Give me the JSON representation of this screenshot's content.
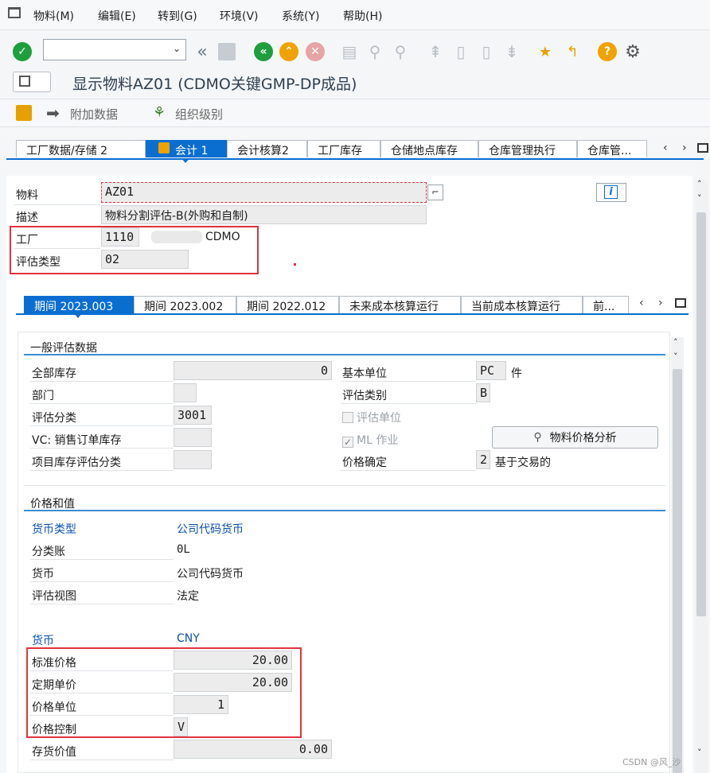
{
  "menu": [
    "物料(M)",
    "编辑(E)",
    "转到(G)",
    "环境(V)",
    "系统(Y)",
    "帮助(H)"
  ],
  "title": "显示物料AZ01 (CDMO关键GMP-DP成品)",
  "appbar": {
    "additional_data": "附加数据",
    "org_levels": "组织级别"
  },
  "main_tabs": [
    "工厂数据/存储 2",
    "会计 1",
    "会计核算2",
    "工厂库存",
    "仓储地点库存",
    "仓库管理执行",
    "仓库管..."
  ],
  "header": {
    "material_label": "物料",
    "material_value": "AZ01",
    "desc_label": "描述",
    "desc_value": "物料分割评估-B(外购和自制)",
    "plant_label": "工厂",
    "plant_value": "1110",
    "plant_desc": "CDMO",
    "valtype_label": "评估类型",
    "valtype_value": "02"
  },
  "period_tabs": [
    "期间 2023.003",
    "期间 2023.002",
    "期间 2022.012",
    "未来成本核算运行",
    "当前成本核算运行",
    "前..."
  ],
  "general": {
    "title": "一般评估数据",
    "total_stock_label": "全部库存",
    "total_stock_value": "0",
    "base_unit_label": "基本单位",
    "base_unit_value": "PC",
    "base_unit_text": "件",
    "division_label": "部门",
    "division_value": "",
    "val_category_label": "评估类别",
    "val_category_value": "B",
    "val_class_label": "评估分类",
    "val_class_value": "3001",
    "val_unit_label": "评估单位",
    "vc_label": "VC: 销售订单库存",
    "vc_value": "",
    "ml_label": "ML 作业",
    "price_analysis_button": "物料价格分析",
    "project_label": "项目库存评估分类",
    "project_value": "",
    "price_det_label": "价格确定",
    "price_det_value": "2",
    "price_det_text": "基于交易的"
  },
  "prices": {
    "title": "价格和值",
    "currency_type_label": "货币类型",
    "currency_type_value": "公司代码货币",
    "ledger_label": "分类账",
    "ledger_value": "0L",
    "currency_label": "货币",
    "currency_value": "公司代码货币",
    "view_label": "评估视图",
    "view_value": "法定",
    "curr2_label": "货币",
    "curr2_value": "CNY",
    "std_price_label": "标准价格",
    "std_price_value": "20.00",
    "periodic_price_label": "定期单价",
    "periodic_price_value": "20.00",
    "price_unit_label": "价格单位",
    "price_unit_value": "1",
    "price_control_label": "价格控制",
    "price_control_value": "V",
    "inventory_value_label": "存货价值",
    "inventory_value_value": "0.00"
  },
  "watermark": "CSDN @风_沙"
}
